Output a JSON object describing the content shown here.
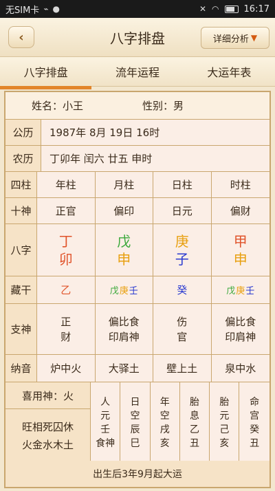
{
  "status": {
    "carrier": "无SIM卡",
    "time": "16:17"
  },
  "header": {
    "title": "八字排盘",
    "detail_button": "详细分析",
    "detail_arrow": "▼",
    "back": "‹"
  },
  "tabs": [
    "八字排盘",
    "流年运程",
    "大运年表"
  ],
  "info": {
    "name_label": "姓名：",
    "name_value": "小王",
    "gender_label": "性别：",
    "gender_value": "男",
    "gongli_label": "公历",
    "gongli_value": "1987年 8月 19日 16时",
    "nongli_label": "农历",
    "nongli_value": "丁卯年 闰六 廿五 申时"
  },
  "table": {
    "row_labels": {
      "sizhu": "四柱",
      "shishen": "十神",
      "bazi": "八字",
      "canggan": "藏干",
      "zhishen": "支神",
      "nayin": "纳音"
    },
    "pillars": [
      "年柱",
      "月柱",
      "日柱",
      "时柱"
    ],
    "shishen": [
      "正官",
      "偏印",
      "日元",
      "偏财"
    ],
    "bazi": [
      {
        "stem": "丁",
        "branch": "卯",
        "stem_color": "#e0532a",
        "branch_color": "#e0532a"
      },
      {
        "stem": "戊",
        "branch": "申",
        "stem_color": "#3aa83a",
        "branch_color": "#e8a010"
      },
      {
        "stem": "庚",
        "branch": "子",
        "stem_color": "#e8a010",
        "branch_color": "#2a3ad0"
      },
      {
        "stem": "甲",
        "branch": "申",
        "stem_color": "#e0532a",
        "branch_color": "#e8a010"
      }
    ],
    "canggan": [
      [
        {
          "ch": "乙",
          "color": "#e0532a"
        }
      ],
      [
        {
          "ch": "戊",
          "color": "#3aa83a"
        },
        {
          "ch": "庚",
          "color": "#e8a010"
        },
        {
          "ch": "壬",
          "color": "#2a3ad0"
        }
      ],
      [
        {
          "ch": "癸",
          "color": "#2a3ad0"
        }
      ],
      [
        {
          "ch": "戊",
          "color": "#3aa83a"
        },
        {
          "ch": "庚",
          "color": "#e8a010"
        },
        {
          "ch": "壬",
          "color": "#2a3ad0"
        }
      ]
    ],
    "zhishen": [
      [
        "正",
        "财"
      ],
      [
        "偏比食",
        "印肩神"
      ],
      [
        "伤",
        "官"
      ],
      [
        "偏比食",
        "印肩神"
      ]
    ],
    "nayin": [
      "炉中火",
      "大驿土",
      "壁上土",
      "泉中水"
    ]
  },
  "bottom": {
    "xiyong_label": "喜用神：火",
    "wangxiang_top": "旺相死囚休",
    "wangxiang_bottom": "火金水木土",
    "columns": [
      [
        "人",
        "元",
        "壬",
        "食神"
      ],
      [
        "日",
        "空",
        "辰",
        "巳"
      ],
      [
        "年",
        "空",
        "戌",
        "亥"
      ],
      [
        "胎",
        "息",
        "乙",
        "丑"
      ],
      [
        "胎",
        "元",
        "己",
        "亥"
      ],
      [
        "命",
        "宫",
        "癸",
        "丑"
      ]
    ]
  },
  "footer": "出生后3年9月起大运",
  "colors": {
    "accent": "#e2852a",
    "border": "#c9a66e",
    "bg": "#f3e7cf"
  }
}
